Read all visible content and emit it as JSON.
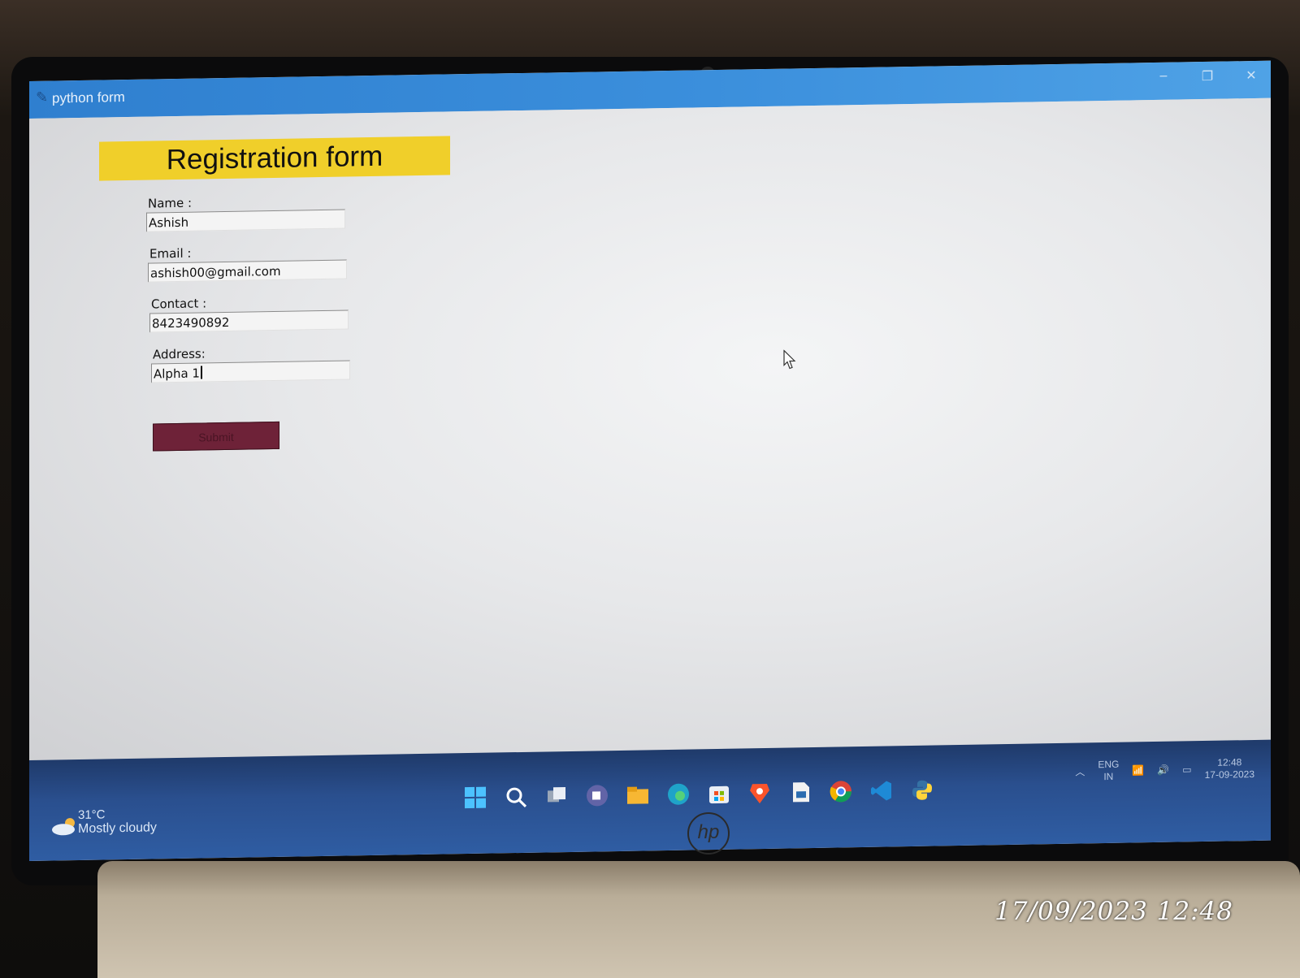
{
  "window": {
    "title": "python form",
    "controls": [
      "–",
      "❐",
      "✕"
    ]
  },
  "form": {
    "heading": "Registration form",
    "fields": [
      {
        "label": "Name :",
        "value": "Ashish"
      },
      {
        "label": "Email :",
        "value": "ashish00@gmail.com"
      },
      {
        "label": "Contact :",
        "value": "8423490892"
      },
      {
        "label": "Address:",
        "value": "Alpha 1"
      }
    ],
    "submit_label": "Submit",
    "colors": {
      "heading_bg": "#f0cf2a",
      "submit_bg": "#6e2238"
    }
  },
  "taskbar": {
    "weather_temp": "31°C",
    "weather_desc": "Mostly cloudy",
    "icons": [
      "windows-start-icon",
      "search-icon",
      "task-view-icon",
      "teams-chat-icon",
      "file-explorer-icon",
      "edge-icon",
      "store-icon",
      "brave-icon",
      "pdf-reader-icon",
      "chrome-icon",
      "vscode-icon",
      "python-icon"
    ],
    "tray": {
      "lang": "ENG",
      "region": "IN",
      "time": "12:48",
      "date": "17-09-2023"
    }
  },
  "photo_timestamp": "17/09/2023  12:48"
}
